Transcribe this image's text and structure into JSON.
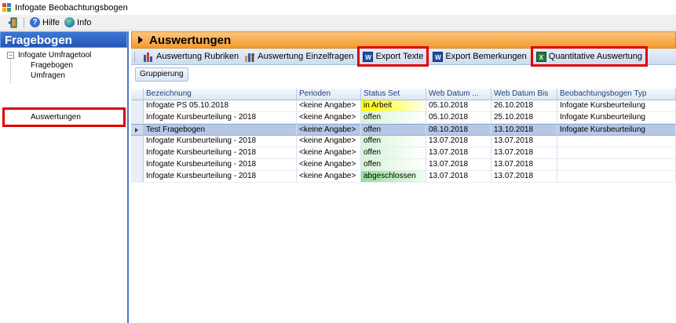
{
  "window": {
    "title": "Infogate Beobachtungsbogen"
  },
  "menubar": {
    "help_label": "Hilfe",
    "info_label": "Info"
  },
  "sidebar": {
    "title": "Fragebogen",
    "tree": {
      "root_label": "Infogate Umfragetool",
      "root_toggle": "−",
      "children": [
        "Fragebogen",
        "Umfragen",
        "Auswertungen"
      ]
    }
  },
  "main": {
    "title": "Auswertungen",
    "toolbar": {
      "rubriken_label": "Auswertung Rubriken",
      "einzelfragen_label": "Auswertung Einzelfragen",
      "export_texte_label": "Export Texte",
      "export_bemerkungen_label": "Export Bemerkungen",
      "quantitative_label": "Quantitative Auswertung"
    },
    "group_button_label": "Gruppierung",
    "table": {
      "headers": [
        "Bezeichnung",
        "Perioden",
        "Status Set",
        "Web Datum ...",
        "Web Datum Bis",
        "Beobachtungsbogen Typ"
      ],
      "rows": [
        {
          "bezeichnung": "Infogate PS 05.10.2018",
          "perioden": "<keine Angabe>",
          "status": "in Arbeit",
          "web_von": "05.10.2018",
          "web_bis": "26.10.2018",
          "typ": "Infogate Kursbeurteilung"
        },
        {
          "bezeichnung": "Infogate Kursbeurteilung - 2018",
          "perioden": "<keine Angabe>",
          "status": "offen",
          "web_von": "05.10.2018",
          "web_bis": "25.10.2018",
          "typ": "Infogate Kursbeurteilung"
        },
        {
          "bezeichnung": "Test Fragebogen",
          "perioden": "<keine Angabe>",
          "status": "offen",
          "web_von": "08.10.2018",
          "web_bis": "13.10.2018",
          "typ": "Infogate Kursbeurteilung"
        },
        {
          "bezeichnung": "Infogate Kursbeurteilung - 2018",
          "perioden": "<keine Angabe>",
          "status": "offen",
          "web_von": "13.07.2018",
          "web_bis": "13.07.2018",
          "typ": ""
        },
        {
          "bezeichnung": "Infogate Kursbeurteilung - 2018",
          "perioden": "<keine Angabe>",
          "status": "offen",
          "web_von": "13.07.2018",
          "web_bis": "13.07.2018",
          "typ": ""
        },
        {
          "bezeichnung": "Infogate Kursbeurteilung - 2018",
          "perioden": "<keine Angabe>",
          "status": "offen",
          "web_von": "13.07.2018",
          "web_bis": "13.07.2018",
          "typ": ""
        },
        {
          "bezeichnung": "Infogate Kursbeurteilung - 2018",
          "perioden": "<keine Angabe>",
          "status": "abgeschlossen",
          "web_von": "13.07.2018",
          "web_bis": "13.07.2018",
          "typ": ""
        }
      ]
    }
  }
}
